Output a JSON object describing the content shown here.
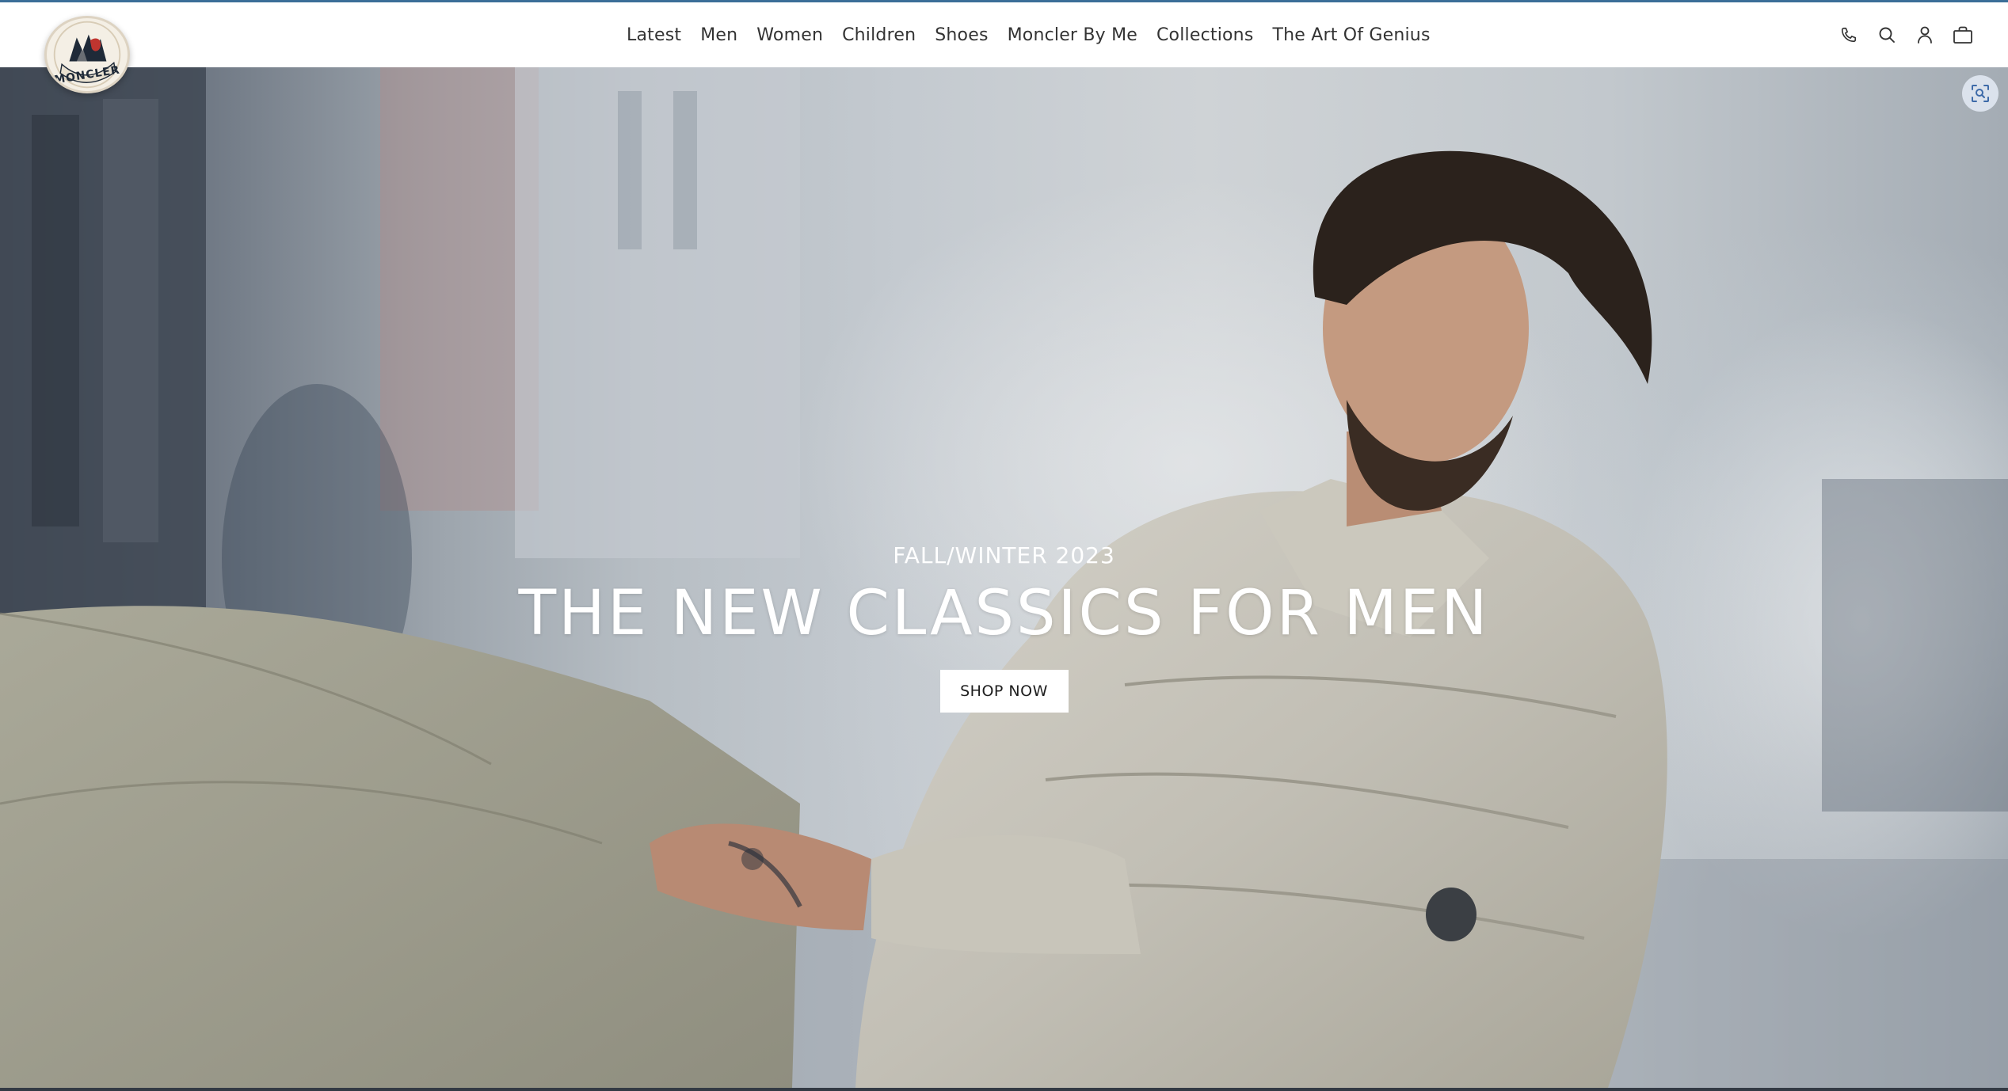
{
  "brand": {
    "name": "Moncler",
    "logo_wordmark": "MONCLER",
    "logo_icon": "moncler-rooster-emblem-icon"
  },
  "nav": {
    "items": [
      {
        "label": "Latest"
      },
      {
        "label": "Men"
      },
      {
        "label": "Women"
      },
      {
        "label": "Children"
      },
      {
        "label": "Shoes"
      },
      {
        "label": "Moncler By Me"
      },
      {
        "label": "Collections"
      },
      {
        "label": "The Art Of Genius"
      }
    ]
  },
  "header_icons": {
    "phone": "phone-icon",
    "search": "search-icon",
    "account": "account-icon",
    "bag": "shopping-bag-icon"
  },
  "hero": {
    "kicker": "FALL/WINTER 2023",
    "title": "THE NEW CLASSICS FOR MEN",
    "cta_label": "SHOP NOW",
    "visual_search_icon": "visual-search-icon"
  },
  "colors": {
    "accent_top": "#3b6e98",
    "nav_text": "#333333",
    "hero_text": "#ffffff",
    "button_bg": "#ffffff",
    "button_text": "#1e1e1e"
  }
}
